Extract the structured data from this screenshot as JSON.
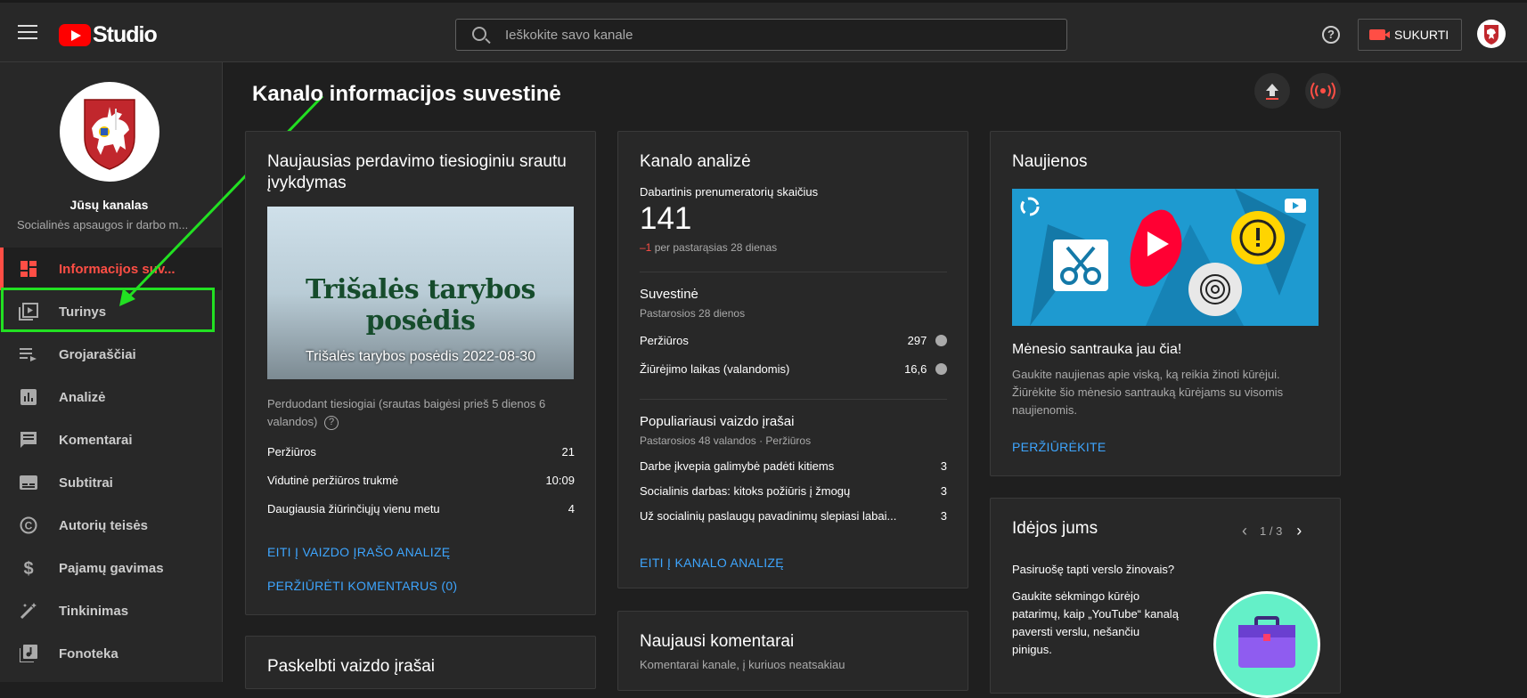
{
  "topbar": {
    "logo_text": "Studio",
    "search_placeholder": "Ieškokite savo kanale",
    "help_label": "?",
    "create_label": "SUKURTI"
  },
  "sidebar": {
    "channel_title": "Jūsų kanalas",
    "channel_subtitle": "Socialinės apsaugos ir darbo m...",
    "items": [
      {
        "label": "Informacijos suv...",
        "icon": "dashboard-icon"
      },
      {
        "label": "Turinys",
        "icon": "content-icon"
      },
      {
        "label": "Grojaraščiai",
        "icon": "playlist-icon"
      },
      {
        "label": "Analizė",
        "icon": "analytics-icon"
      },
      {
        "label": "Komentarai",
        "icon": "comments-icon"
      },
      {
        "label": "Subtitrai",
        "icon": "subtitles-icon"
      },
      {
        "label": "Autorių teisės",
        "icon": "copyright-icon"
      },
      {
        "label": "Pajamų gavimas",
        "icon": "dollar-icon"
      },
      {
        "label": "Tinkinimas",
        "icon": "wand-icon"
      },
      {
        "label": "Fonoteka",
        "icon": "audio-library-icon"
      }
    ]
  },
  "main": {
    "title": "Kanalo informacijos suvestinė",
    "live_card": {
      "title": "Naujausias perdavimo tiesioginiu srautu įvykdymas",
      "thumb_big_text": "Trišalės tarybos posėdis",
      "thumb_caption": "Trišalės tarybos posėdis 2022-08-30",
      "status": "Perduodant tiesiogiai (srautas baigėsi prieš 5 dienos 6 valandos)",
      "stats": [
        {
          "label": "Peržiūros",
          "value": "21"
        },
        {
          "label": "Vidutinė peržiūros trukmė",
          "value": "10:09"
        },
        {
          "label": "Daugiausia žiūrinčiųjų vienu metu",
          "value": "4"
        }
      ],
      "link1": "EITI Į VAIZDO ĮRAŠO ANALIZĘ",
      "link2": "PERŽIŪRĖTI KOMENTARUS (0)"
    },
    "published_card": {
      "title": "Paskelbti vaizdo įrašai"
    },
    "analytics_card": {
      "title": "Kanalo analizė",
      "subs_label": "Dabartinis prenumeratorių skaičius",
      "subs_value": "141",
      "subs_delta": "–1",
      "subs_delta_text": "per pastarąsias 28 dienas",
      "summary_title": "Suvestinė",
      "summary_sub": "Pastarosios 28 dienos",
      "summary": [
        {
          "label": "Peržiūros",
          "value": "297"
        },
        {
          "label": "Žiūrėjimo laikas (valandomis)",
          "value": "16,6"
        }
      ],
      "top_title": "Populiariausi vaizdo įrašai",
      "top_sub": "Pastarosios 48 valandos · Peržiūros",
      "top_videos": [
        {
          "label": "Darbe įkvepia galimybė padėti kitiems",
          "value": "3"
        },
        {
          "label": "Socialinis darbas: kitoks požiūris į žmogų",
          "value": "3"
        },
        {
          "label": "Už socialinių paslaugų pavadinimų slepiasi labai...",
          "value": "3"
        }
      ],
      "link": "EITI Į KANALO ANALIZĘ"
    },
    "comments_card": {
      "title": "Naujausi komentarai",
      "sub": "Komentarai kanale, į kuriuos neatsakiau"
    },
    "news_card": {
      "title": "Naujienos",
      "headline": "Mėnesio santrauka jau čia!",
      "body": "Gaukite naujienas apie viską, ką reikia žinoti kūrėjui. Žiūrėkite šio mėnesio santrauką kūrėjams su visomis naujienomis.",
      "link": "PERŽIŪRĖKITE"
    },
    "ideas_card": {
      "title": "Idėjos jums",
      "pager": "1 / 3",
      "question": "Pasiruošę tapti verslo žinovais?",
      "body": "Gaukite sėkmingo kūrėjo patarimų, kaip „YouTube“ kanalą paversti verslu, nešančiu pinigus."
    }
  },
  "colors": {
    "accent_red": "#ff4e45",
    "link_blue": "#3ea6ff",
    "highlight_green": "#22e022"
  }
}
